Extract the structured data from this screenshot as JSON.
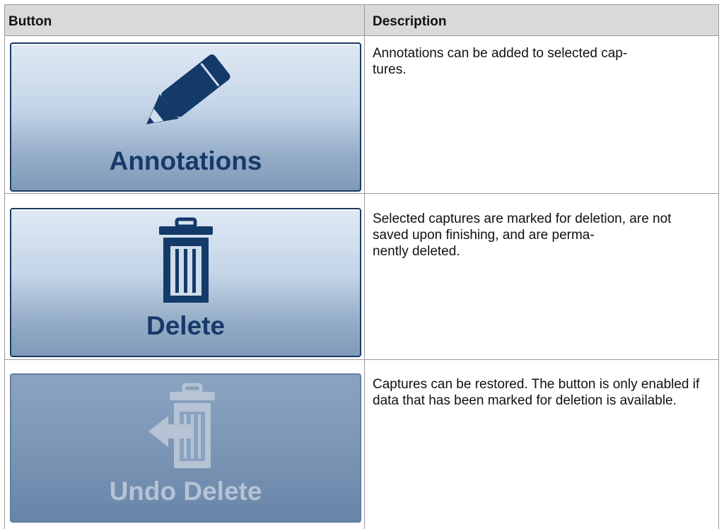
{
  "table": {
    "headers": [
      "Button",
      "Description"
    ],
    "rows": [
      {
        "button_label": "Annotations",
        "icon": "pencil-icon",
        "enabled": true,
        "description": "Annotations can be added to selected cap-\ntures."
      },
      {
        "button_label": "Delete",
        "icon": "trash-icon",
        "enabled": true,
        "description": "Selected captures are marked for deletion, are not saved upon finishing, and are perma-\nnently deleted."
      },
      {
        "button_label": "Undo Delete",
        "icon": "undo-delete-icon",
        "enabled": false,
        "description": "Captures can be restored. The button is only enabled if data that has been marked for deletion is available."
      }
    ]
  },
  "colors": {
    "header_bg": "#d9d9d9",
    "button_text": "#173a6b",
    "button_text_disabled": "#b5c3d4",
    "rule": "#9a9a9a"
  }
}
